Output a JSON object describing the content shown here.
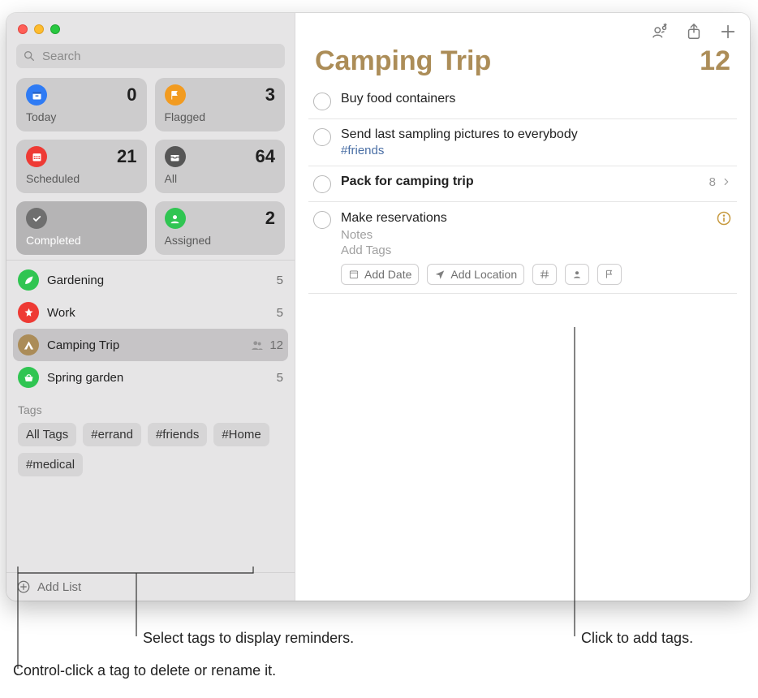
{
  "search": {
    "placeholder": "Search"
  },
  "smart": [
    {
      "label": "Today",
      "count": 0,
      "color": "#2f7bf4",
      "icon": "calendar",
      "dark": false
    },
    {
      "label": "Flagged",
      "count": 3,
      "color": "#f29b20",
      "icon": "flag",
      "dark": false
    },
    {
      "label": "Scheduled",
      "count": 21,
      "color": "#ee3a34",
      "icon": "calendar-grid",
      "dark": false
    },
    {
      "label": "All",
      "count": 64,
      "color": "#565656",
      "icon": "tray",
      "dark": false
    },
    {
      "label": "Completed",
      "count": "",
      "color": "#707070",
      "icon": "check",
      "dark": true
    },
    {
      "label": "Assigned",
      "count": 2,
      "color": "#30c552",
      "icon": "person",
      "dark": false
    }
  ],
  "lists": [
    {
      "name": "Gardening",
      "count": 5,
      "color": "#30c552",
      "icon": "leaf",
      "selected": false,
      "shared": false
    },
    {
      "name": "Work",
      "count": 5,
      "color": "#ee3a34",
      "icon": "star",
      "selected": false,
      "shared": false
    },
    {
      "name": "Camping Trip",
      "count": 12,
      "color": "#ab8c58",
      "icon": "tent",
      "selected": true,
      "shared": true
    },
    {
      "name": "Spring garden",
      "count": 5,
      "color": "#30c552",
      "icon": "basket",
      "selected": false,
      "shared": false
    }
  ],
  "tags_label": "Tags",
  "tags": [
    "All Tags",
    "#errand",
    "#friends",
    "#Home",
    "#medical"
  ],
  "add_list_label": "Add List",
  "list_header": {
    "title": "Camping Trip",
    "count": 12
  },
  "reminders": [
    {
      "title": "Buy food containers"
    },
    {
      "title": "Send last sampling pictures to everybody",
      "tag": "#friends"
    },
    {
      "title": "Pack for camping trip",
      "bold": true,
      "subtask_count": 8,
      "chevron": true
    },
    {
      "title": "Make reservations",
      "editing": true,
      "notes_placeholder": "Notes",
      "addtags_placeholder": "Add Tags",
      "pills": {
        "date": "Add Date",
        "location": "Add Location"
      }
    }
  ],
  "callouts": {
    "tags_select": "Select tags to display reminders.",
    "tags_ctrl": "Control-click a tag to delete or rename it.",
    "add_tags": "Click to add tags."
  }
}
